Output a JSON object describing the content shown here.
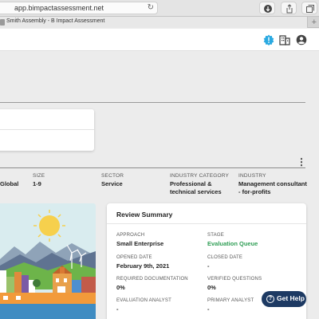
{
  "browser": {
    "url": "app.bimpactassessment.net",
    "tab_title": "Smith Assembly - B Impact Assessment",
    "new_tab": "+"
  },
  "header": {
    "icons": [
      "notification-badge-icon",
      "building-icon",
      "account-icon"
    ],
    "accent_color": "#29a9e1"
  },
  "company_info": {
    "location_value": "Global",
    "size_label": "SIZE",
    "size_value": "1-9",
    "sector_label": "SECTOR",
    "sector_value": "Service",
    "industry_category_label": "INDUSTRY CATEGORY",
    "industry_category_value": "Professional & technical services",
    "industry_label": "INDUSTRY",
    "industry_value": "Management consultant - for-profits"
  },
  "review_summary": {
    "title": "Review Summary",
    "approach_label": "APPROACH",
    "approach_value": "Small Enterprise",
    "stage_label": "STAGE",
    "stage_value": "Evaluation Queue",
    "opened_label": "OPENED DATE",
    "opened_value": "February 9th, 2021",
    "closed_label": "CLOSED DATE",
    "closed_value": "-",
    "required_docs_label": "REQUIRED DOCUMENTATION",
    "required_docs_value": "0%",
    "verified_label": "VERIFIED QUESTIONS",
    "verified_value": "0%",
    "analyst_label": "EVALUATION ANALYST",
    "analyst_value": "-",
    "primary_label": "PRIMARY ANALYST",
    "primary_value": "-",
    "stage_color": "#2f9e55"
  },
  "help": {
    "label": "Get Help",
    "icon_glyph": "?"
  }
}
